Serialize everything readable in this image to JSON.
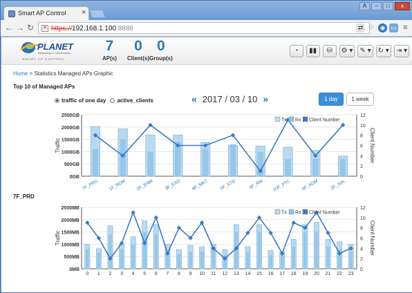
{
  "browser": {
    "tab_title": "Smart AP Control",
    "tab_close": "×",
    "url_scheme": "https://",
    "url_host": "192.168.1.100",
    "url_port": ":8888",
    "window_buttons": [
      "A",
      "–",
      "□",
      "x"
    ]
  },
  "header": {
    "logo_text": "PLANET",
    "logo_tagline": "Networking & Communication",
    "logo_sub": "SMART AP CONTROL",
    "stats": [
      {
        "value": "7",
        "label": "AP(s)"
      },
      {
        "value": "0",
        "label": "Client(s)"
      },
      {
        "value": "0",
        "label": "Group(s)"
      }
    ]
  },
  "breadcrumb": {
    "home": "Home",
    "sep": " > ",
    "current": "Statistics Managed APs Graphic"
  },
  "section_title": "Top 10 of Managed APs",
  "options": {
    "traffic": "traffic of one day",
    "clients": "active_clients"
  },
  "date": {
    "prev": "«",
    "label": "2017 / 03 / 10",
    "next": "»"
  },
  "range": {
    "day": "1 day",
    "week": "1 week"
  },
  "ap_label": "7F_PRD",
  "colors": {
    "tx": "#b9d9ee",
    "rx": "#8fc3e6",
    "line": "#3d78c3",
    "accent": "#2a7ab8"
  },
  "chart_data": [
    {
      "type": "bar",
      "categories": [
        "7F_PRD",
        "1F_RDM",
        "2F_ENM",
        "3F_EXD",
        "8F_MKT",
        "5F_STD",
        "6F_RM",
        "10F_PTC",
        "4F_ADM",
        "2F_SAL"
      ],
      "series": [
        {
          "name": "Tx",
          "values": [
            2020,
            1930,
            1680,
            1680,
            1380,
            1260,
            1230,
            1180,
            1050,
            820
          ]
        },
        {
          "name": "Rx",
          "values": [
            1100,
            1500,
            1000,
            1400,
            1100,
            1300,
            1000,
            700,
            700,
            700
          ]
        },
        {
          "name": "Client Number",
          "values": [
            8,
            4,
            10,
            6,
            6,
            8,
            1,
            11,
            4,
            10
          ]
        }
      ],
      "y_ticks": [
        "0GB",
        "500GB",
        "1000GB",
        "1500GB",
        "2000GB",
        "2500GB"
      ],
      "ylim": [
        0,
        2500
      ],
      "y2_ticks": [
        "0",
        "2",
        "4",
        "6",
        "8",
        "10",
        "12"
      ],
      "y2lim": [
        0,
        12
      ],
      "ylabel": "Traffic",
      "y2label": "Client Number",
      "legend": [
        "Tx",
        "Rx",
        "Client Number"
      ]
    },
    {
      "type": "bar",
      "categories": [
        "0",
        "1",
        "2",
        "3",
        "4",
        "5",
        "6",
        "7",
        "8",
        "9",
        "10",
        "11",
        "12",
        "13",
        "14",
        "15",
        "16",
        "17",
        "18",
        "19",
        "20",
        "21",
        "22",
        "23"
      ],
      "series": [
        {
          "name": "Tx",
          "values": [
            1000,
            820,
            1750,
            1000,
            1300,
            1950,
            1800,
            1000,
            780,
            950,
            900,
            1000,
            780,
            1800,
            900,
            1800,
            750,
            700,
            1200,
            1800,
            1900,
            1200,
            1100,
            1000
          ]
        },
        {
          "name": "Rx",
          "values": [
            800,
            650,
            1400,
            800,
            1000,
            1500,
            1400,
            700,
            600,
            700,
            700,
            800,
            550,
            1500,
            700,
            1500,
            550,
            550,
            900,
            1500,
            1500,
            900,
            800,
            700
          ]
        },
        {
          "name": "Client Number",
          "values": [
            9,
            6,
            2,
            5,
            11,
            5,
            10,
            3,
            8,
            6,
            9,
            4,
            2,
            4,
            7,
            10,
            7,
            3,
            9,
            8,
            11,
            7,
            3,
            4
          ]
        }
      ],
      "y_ticks": [
        "0MB",
        "500MB",
        "1000MB",
        "1500MB",
        "2000MB",
        "2500MB"
      ],
      "ylim": [
        0,
        2500
      ],
      "y2_ticks": [
        "0",
        "2",
        "4",
        "6",
        "8",
        "10",
        "12"
      ],
      "y2lim": [
        0,
        12
      ],
      "ylabel": "Traffic",
      "y2label": "Client Number",
      "legend": [
        "Tx",
        "Rx",
        "Client Number"
      ]
    }
  ]
}
